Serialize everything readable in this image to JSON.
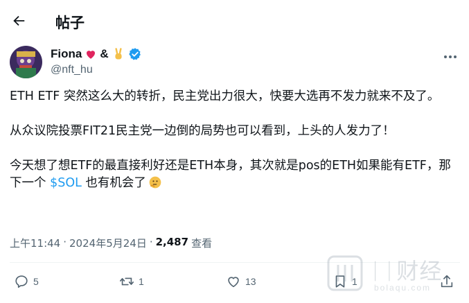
{
  "header": {
    "title": "帖子",
    "back_icon": "arrow-left-icon"
  },
  "author": {
    "name": "Fiona",
    "name_suffix": "&",
    "heart_icon": "red-heart-icon",
    "peace_icon": "victory-hand-icon",
    "verified_icon": "verified-badge-icon",
    "handle": "@nft_hu"
  },
  "post": {
    "paragraph1": "ETH ETF 突然这么大的转折，民主党出力很大，快要大选再不发力就来不及了。",
    "paragraph2": "从众议院投票FIT21民主党一边倒的局势也可以看到，上头的人发力了！",
    "paragraph3_before": "今天想了想ETF的最直接利好还是ETH本身，其次就是pos的ETH如果能有ETF，那下一个 ",
    "cashtag": "$SOL",
    "paragraph3_after": " 也有机会了",
    "emoji": "thinking-face-icon"
  },
  "meta": {
    "time": "上午11:44",
    "dot": "·",
    "date": "2024年5月24日",
    "dot2": "·",
    "views_count": "2,487",
    "views_label": "查看"
  },
  "actions": {
    "replies": "5",
    "reposts": "1",
    "likes": "13",
    "bookmarks": "1"
  },
  "watermark": {
    "text": "ᛁᛁ财经",
    "sub": "bolaqu.com"
  },
  "colors": {
    "accent": "#1d9bf0",
    "heart": "#f91880",
    "text": "#0f1419",
    "muted": "#536471"
  }
}
